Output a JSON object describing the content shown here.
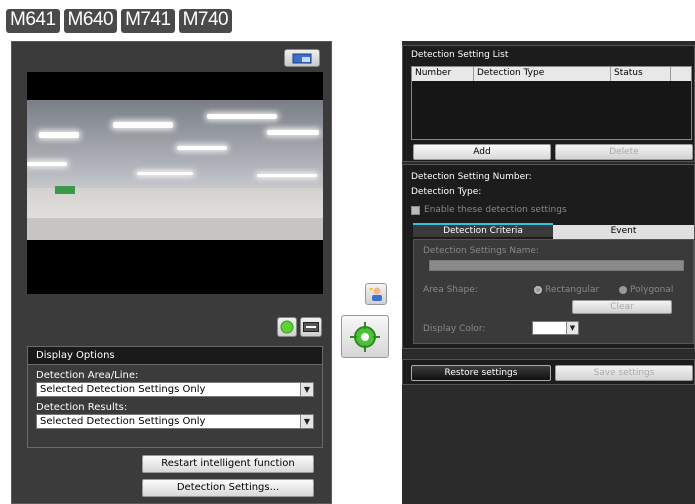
{
  "models": [
    "M641",
    "M640",
    "M741",
    "M740"
  ],
  "display_options": {
    "title": "Display Options",
    "area_label": "Detection Area/Line:",
    "area_value": "Selected Detection Settings Only",
    "results_label": "Detection Results:",
    "results_value": "Selected Detection Settings Only"
  },
  "buttons": {
    "restart": "Restart intelligent function",
    "detection_settings": "Detection Settings..."
  },
  "list": {
    "title": "Detection Setting List",
    "columns": [
      "Number",
      "Detection Type",
      "Status"
    ],
    "add": "Add",
    "delete": "Delete"
  },
  "setting": {
    "number_label": "Detection Setting Number:",
    "type_label": "Detection Type:",
    "enable_label": "Enable these detection settings",
    "tab_criteria": "Detection Criteria",
    "tab_event": "Event",
    "name_label": "Detection Settings Name:",
    "shape_label": "Area Shape:",
    "shape_rect": "Rectangular",
    "shape_poly": "Polygonal",
    "clear": "Clear",
    "color_label": "Display Color:"
  },
  "footer": {
    "restore": "Restore settings",
    "save": "Save settings"
  },
  "colors": {
    "accent_green": "#5fd135",
    "tab_active": "#2ec4e0"
  }
}
